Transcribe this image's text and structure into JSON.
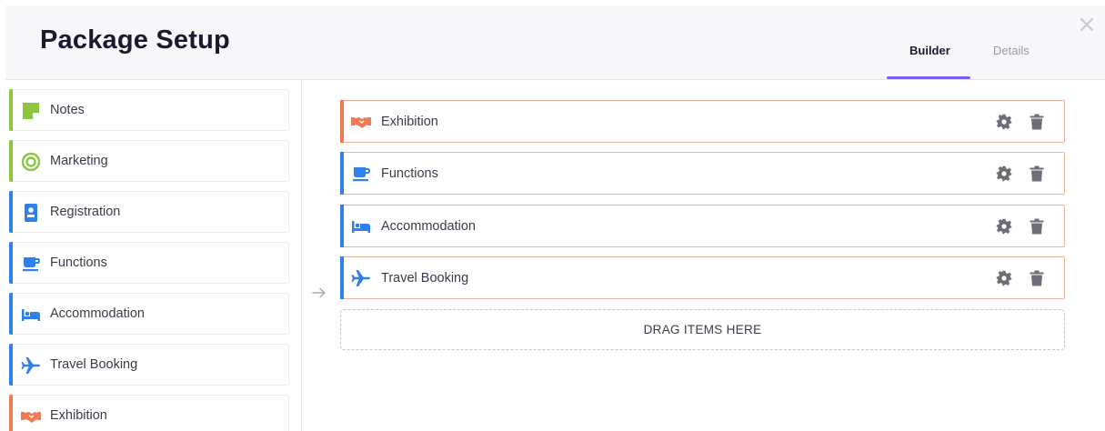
{
  "header": {
    "title": "Package Setup",
    "tabs": [
      {
        "label": "Builder",
        "active": true
      },
      {
        "label": "Details",
        "active": false
      }
    ],
    "close_icon": "close-icon"
  },
  "sidebar": {
    "items": [
      {
        "label": "Notes",
        "icon": "note-icon",
        "color": "#8cc63f"
      },
      {
        "label": "Marketing",
        "icon": "target-icon",
        "color": "#8cc63f"
      },
      {
        "label": "Registration",
        "icon": "badge-icon",
        "color": "#2f80ed"
      },
      {
        "label": "Functions",
        "icon": "coffee-cup-icon",
        "color": "#2f80ed"
      },
      {
        "label": "Accommodation",
        "icon": "bed-icon",
        "color": "#2f80ed"
      },
      {
        "label": "Travel Booking",
        "icon": "airplane-icon",
        "color": "#2f80ed"
      },
      {
        "label": "Exhibition",
        "icon": "handshake-icon",
        "color": "#f07b52"
      }
    ]
  },
  "builder": {
    "items": [
      {
        "label": "Exhibition",
        "icon": "handshake-icon",
        "color": "#f07b52"
      },
      {
        "label": "Functions",
        "icon": "coffee-cup-icon",
        "color": "#2f80ed"
      },
      {
        "label": "Accommodation",
        "icon": "bed-icon",
        "color": "#2f80ed"
      },
      {
        "label": "Travel Booking",
        "icon": "airplane-icon",
        "color": "#2f80ed"
      }
    ],
    "drop_zone_label": "DRAG ITEMS HERE"
  },
  "colors": {
    "accent": "#7b5cf5",
    "item_border": "#f0b29a"
  }
}
